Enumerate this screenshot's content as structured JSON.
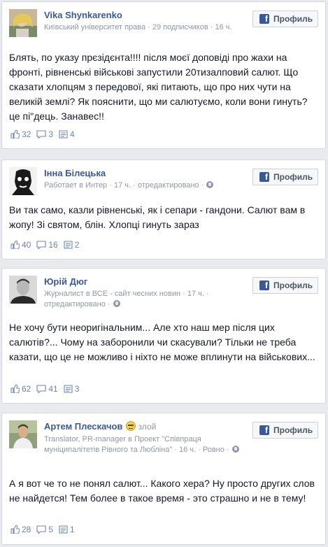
{
  "profile_button_label": "Профиль",
  "posts": [
    {
      "author": "Vika Shynkarenko",
      "subline": "Київський університет права · 29 подписчиков · 16 ч.",
      "text": "Блять, по указу прєзідєнта!!!! після моєї доповіді про жахи на фронті, рівненські військові запустили 20тизалповий салют. Що сказати хлопцям з передової, які питають, що про них чути на великій землі? Як пояснити, що ми салютуємо, коли вони гинуть?це пі\"дець. Занавес!!",
      "likes": "32",
      "comments": "3",
      "shares": "4"
    },
    {
      "author": "Інна Білецька",
      "subline_pre": "Работает в ",
      "place": "Интер",
      "subline_post": " · 17 ч. · отредактировано ·",
      "text": "Ви так само, казли рівненські, як і сепари - гандони. Салют вам в жопу! Зі святом, блін. Хлопці гинуть зараз",
      "likes": "40",
      "comments": "16",
      "shares": "2"
    },
    {
      "author": "Юрій Дюг",
      "subline_pre": "Журналист в ",
      "place": "ВСЕ - сайт чесних новин",
      "subline_post": " · 17 ч. · отредактировано ·",
      "text": "Не хочу бути неоригінальним... Але хто наш мер після цих салютів?... Чому на заборонили чи скасували? Тільки не треба казати, що це не можливо і ніхто не може вплинути на військових...",
      "likes": "62",
      "comments": "41",
      "shares": "3"
    },
    {
      "author": "Артем Плескачов",
      "mood": "злой",
      "subline_pre": "Translator, PR-manager в ",
      "place": "Проект \"Співпраця муніципалітетів Рівного та Любліна\"",
      "subline_post": " · 16 ч. · Ровно ·",
      "text": "А я вот че то не понял салют... Какого хера? Ну просто других слов не найдется! Тем более в такое время - это страшно и не в тему!",
      "likes": "28",
      "comments": "5",
      "shares": "1"
    }
  ],
  "colors": {
    "background": "#e9eaed",
    "link": "#3b5998",
    "meta": "#9197a3",
    "stats": "#6d84b4"
  },
  "icons": [
    "like-icon",
    "comment-icon",
    "share-icon",
    "facebook-logo-icon",
    "globe-icon",
    "angry-emoji-icon"
  ]
}
